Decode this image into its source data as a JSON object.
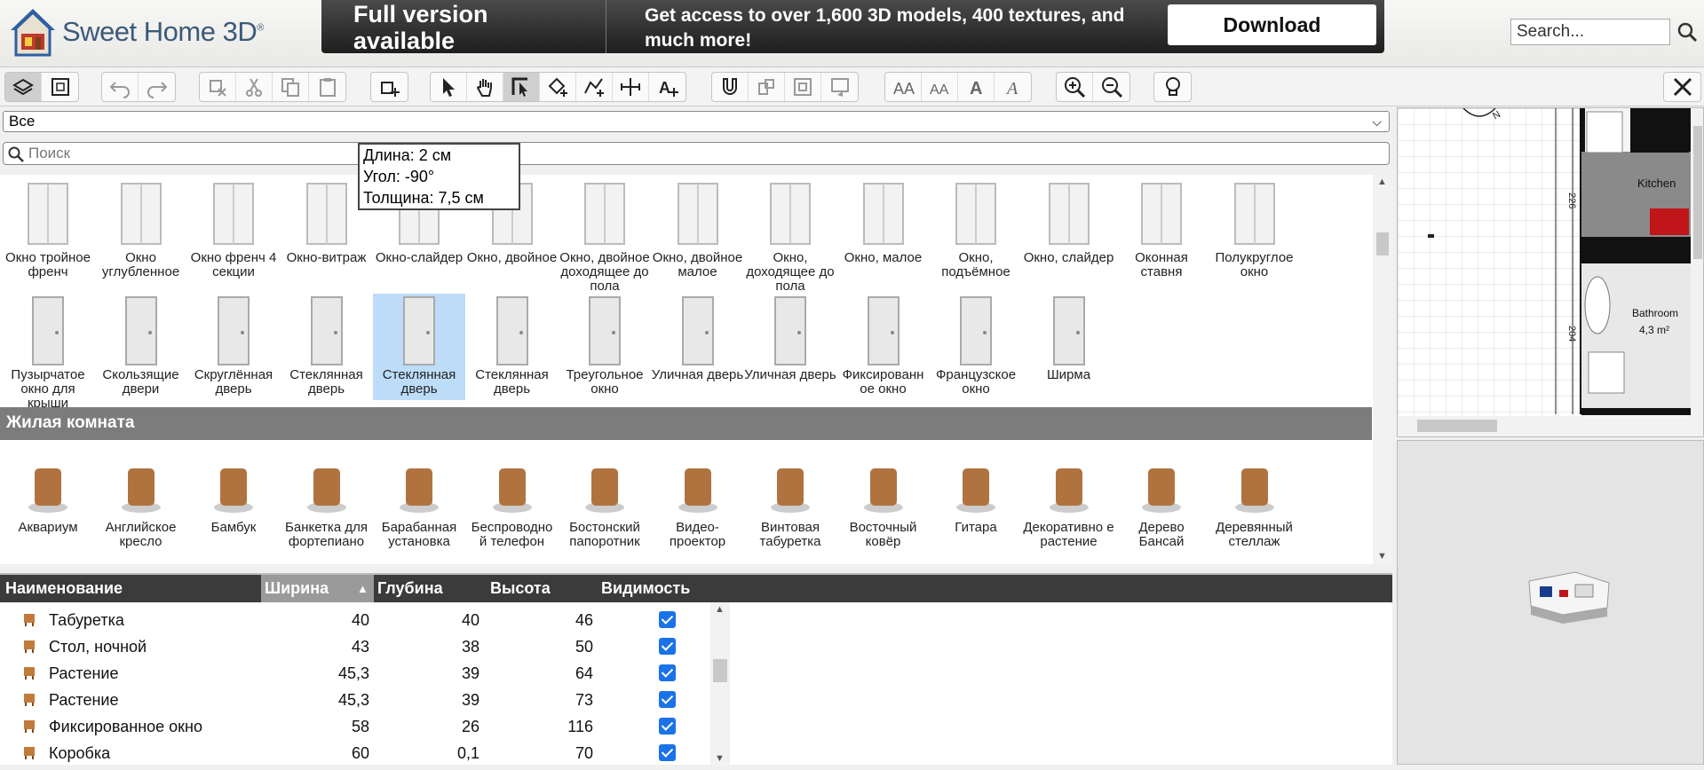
{
  "app": {
    "name": "Sweet Home 3D",
    "trademark": "®"
  },
  "promo": {
    "title": "Full version available",
    "text": "Get access to over 1,600 3D models, 400 textures, and much more!",
    "download_label": "Download"
  },
  "top_search": {
    "placeholder": "Search..."
  },
  "catalog": {
    "category_selected": "Все",
    "search_placeholder": "Поиск",
    "row1": [
      "Окно тройное френч",
      "Окно углубленное",
      "Окно френч 4 секции",
      "Окно-витраж",
      "Окно-слайдер",
      "Окно, двойное",
      "Окно, двойное доходящее до пола",
      "Окно, двойное малое",
      "Окно, доходящее до пола",
      "Окно, малое",
      "Окно, подъёмное",
      "Окно, слайдер",
      "Оконная ставня",
      "Полукруглое окно"
    ],
    "row2": [
      "Пузырчатое окно для крыши",
      "Скользящие двери",
      "Скруглённая дверь",
      "Стеклянная дверь",
      "Стеклянная дверь",
      "Стеклянная дверь",
      "Треугольное окно",
      "Уличная дверь",
      "Уличная дверь",
      "Фиксированн ое окно",
      "Французское окно",
      "Ширма"
    ],
    "section_title": "Жилая комната",
    "row3": [
      "Аквариум",
      "Английское кресло",
      "Бамбук",
      "Банкетка для фортепиано",
      "Барабанная установка",
      "Беспроводно й телефон",
      "Бостонский папоротник",
      "Видео-проектор",
      "Винтовая табуретка",
      "Восточный ковёр",
      "Гитара",
      "Декоративно е растение",
      "Дерево Бансай",
      "Деревянный стеллаж"
    ]
  },
  "tooltip": {
    "length": "Длина: 2 см",
    "angle": "Угол: -90°",
    "thickness": "Толщина: 7,5 см"
  },
  "furniture_table": {
    "headers": {
      "name": "Наименование",
      "width": "Ширина",
      "depth": "Глубина",
      "height": "Высота",
      "visible": "Видимость"
    },
    "rows": [
      {
        "name": "Табуретка",
        "width": "40",
        "depth": "40",
        "height": "46",
        "visible": true
      },
      {
        "name": "Стол, ночной",
        "width": "43",
        "depth": "38",
        "height": "50",
        "visible": true
      },
      {
        "name": "Растение",
        "width": "45,3",
        "depth": "39",
        "height": "64",
        "visible": true
      },
      {
        "name": "Растение",
        "width": "45,3",
        "depth": "39",
        "height": "73",
        "visible": true
      },
      {
        "name": "Фиксированное окно",
        "width": "58",
        "depth": "26",
        "height": "116",
        "visible": true
      },
      {
        "name": "Коробка",
        "width": "60",
        "depth": "0,1",
        "height": "70",
        "visible": true
      }
    ]
  },
  "plan": {
    "room1": "Kitchen",
    "room2": "Bathroom",
    "room2_area": "4,3 m²",
    "dim1": "226",
    "dim2": "204"
  },
  "colors": {
    "selection": "#bcdcf8",
    "section": "#7c7c7c",
    "checkbox": "#1a73e8"
  }
}
